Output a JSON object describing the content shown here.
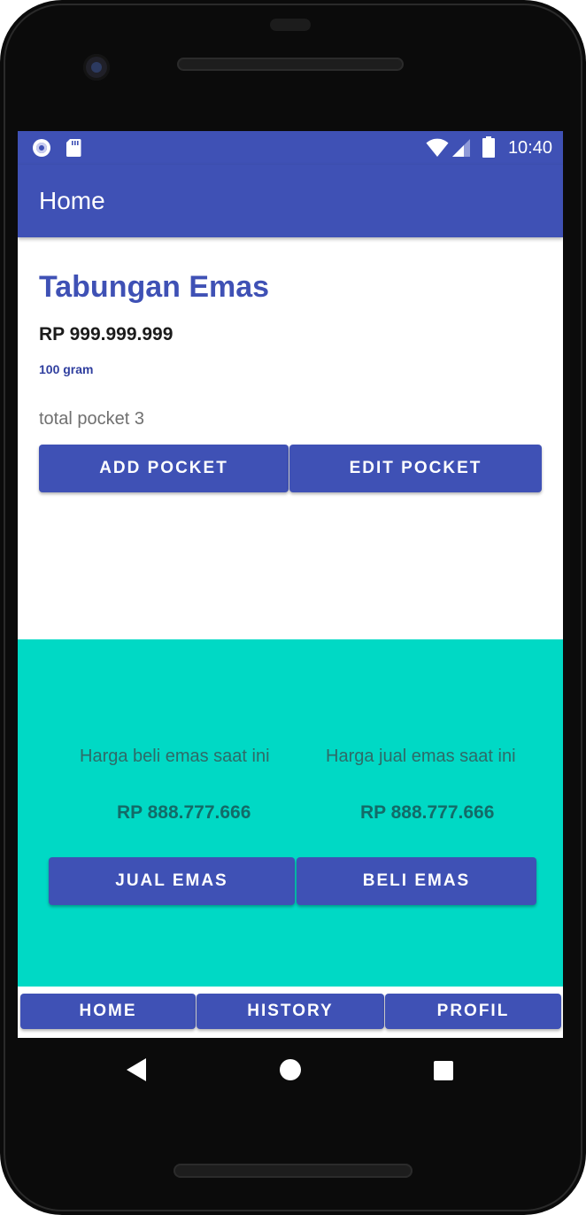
{
  "status_bar": {
    "time": "10:40",
    "icons": [
      "notification-circle-icon",
      "sd-card-icon",
      "wifi-icon",
      "cellular-signal-icon",
      "battery-icon"
    ]
  },
  "app_bar": {
    "title": "Home"
  },
  "savings": {
    "title": "Tabungan Emas",
    "amount": "RP 999.999.999",
    "weight": "100 gram",
    "pocket_count": "total pocket 3",
    "add_pocket_label": "ADD POCKET",
    "edit_pocket_label": "EDIT POCKET"
  },
  "prices": {
    "buy_label": "Harga beli emas saat ini",
    "sell_label": "Harga jual emas saat ini",
    "buy_value": "RP 888.777.666",
    "sell_value": "RP 888.777.666",
    "sell_button_label": "JUAL EMAS",
    "buy_button_label": "BELI EMAS"
  },
  "bottom_nav": {
    "items": [
      {
        "label": "HOME"
      },
      {
        "label": "HISTORY"
      },
      {
        "label": "PROFIL"
      }
    ]
  },
  "system_nav": {
    "icons": [
      "back-icon",
      "home-circle-icon",
      "recents-square-icon"
    ]
  },
  "colors": {
    "primary": "#3f51b5",
    "price_panel": "#00d9c5",
    "title_text": "#3f51b5",
    "price_text": "#136b68"
  }
}
